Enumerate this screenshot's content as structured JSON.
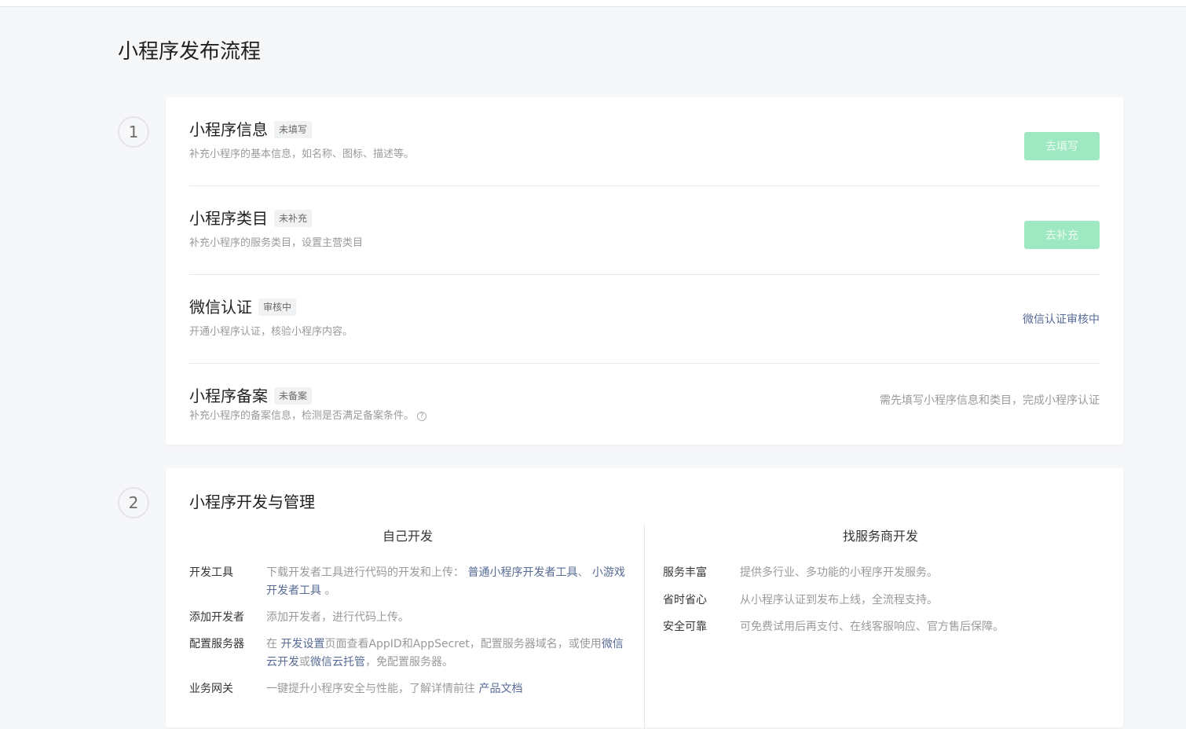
{
  "page": {
    "title": "小程序发布流程"
  },
  "steps": [
    "1",
    "2"
  ],
  "section1": {
    "rows": [
      {
        "title": "小程序信息",
        "tag": "未填写",
        "desc": "补充小程序的基本信息，如名称、图标、描述等。",
        "action": "去填写"
      },
      {
        "title": "小程序类目",
        "tag": "未补充",
        "desc": "补充小程序的服务类目，设置主营类目",
        "action": "去补充"
      },
      {
        "title": "微信认证",
        "tag": "审核中",
        "desc": "开通小程序认证，核验小程序内容。",
        "action": "微信认证审核中"
      },
      {
        "title": "小程序备案",
        "tag": "未备案",
        "desc": "补充小程序的备案信息，检测是否满足备案条件。",
        "action": "需先填写小程序信息和类目，完成小程序认证"
      }
    ]
  },
  "section2": {
    "title": "小程序开发与管理",
    "self": {
      "heading": "自己开发",
      "items": [
        {
          "label": "开发工具",
          "text1": "下载开发者工具进行代码的开发和上传：",
          "link1": "普通小程序开发者工具",
          "text2": "、",
          "link2": "小游戏",
          "text3": "",
          "line2_link": "开发者工具",
          "line2_text": "。"
        },
        {
          "label": "添加开发者",
          "text": "添加开发者，进行代码上传。"
        },
        {
          "label": "配置服务器",
          "text1": "在",
          "link1": "开发设置",
          "text2": "页面查看AppID和AppSecret，配置服务器域名，或使用",
          "link2": "微信",
          "line2_link1": "云开发",
          "line2_text1": "或",
          "line2_link2": "微信云托管",
          "line2_text2": "，免配置服务器。"
        },
        {
          "label": "业务网关",
          "text": "一键提升小程序安全与性能，了解详情前往",
          "link": "产品文档"
        }
      ]
    },
    "vendor": {
      "heading": "找服务商开发",
      "items": [
        {
          "label": "服务丰富",
          "text": "提供多行业、多功能的小程序开发服务。"
        },
        {
          "label": "省时省心",
          "text": "从小程序认证到发布上线，全流程支持。"
        },
        {
          "label": "安全可靠",
          "text": "可免费试用后再支付、在线客服响应、官方售后保障。"
        }
      ]
    }
  }
}
